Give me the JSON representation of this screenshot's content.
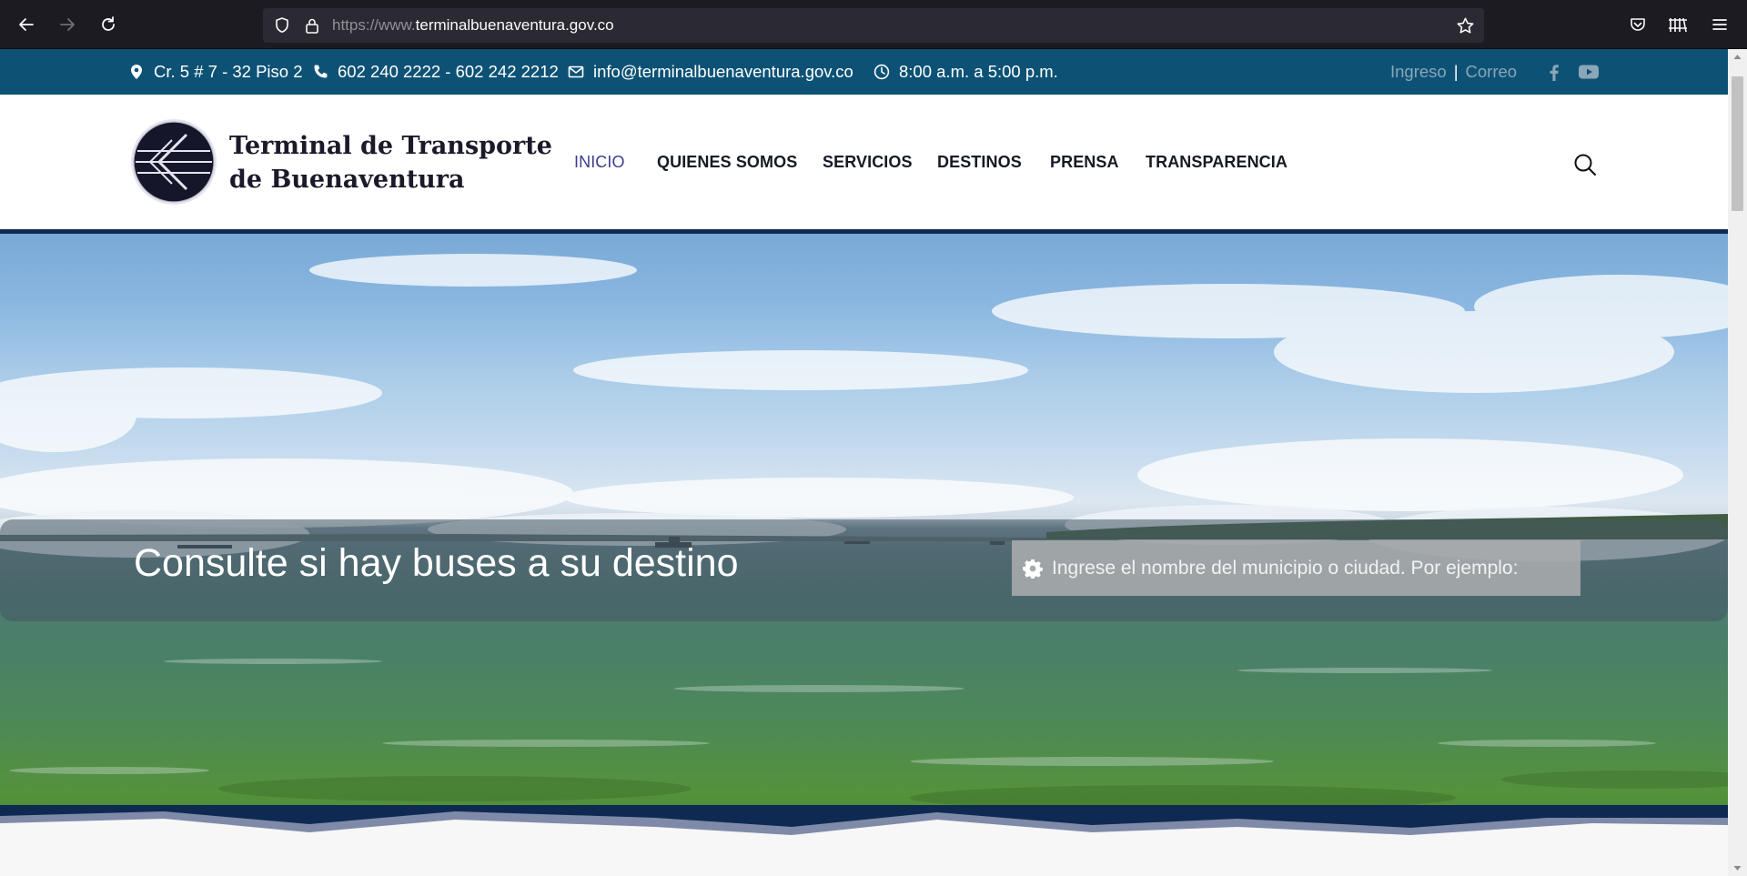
{
  "browser": {
    "url_prefix": "https://www.",
    "url_domain": "terminalbuenaventura.gov.co"
  },
  "topbar": {
    "address": "Cr. 5 # 7 - 32 Piso 2",
    "phone": "602 240 2222 - 602 242 2212",
    "email": "info@terminalbuenaventura.gov.co",
    "hours": "8:00 a.m. a 5:00 p.m.",
    "login_link": "Ingreso",
    "separator": "|",
    "mail_link": "Correo",
    "social_icons": [
      "facebook-icon",
      "youtube-icon"
    ]
  },
  "header": {
    "logo_line1": "Terminal de Transporte",
    "logo_line2": "de Buenaventura",
    "menu": [
      "INICIO",
      "QUIENES SOMOS",
      "SERVICIOS",
      "DESTINOS",
      "PRENSA",
      "TRANSPARENCIA"
    ],
    "active_menu": "INICIO"
  },
  "hero": {
    "title": "Consulte si hay buses a su destino",
    "search_placeholder": "Ingrese el nombre del municipio o ciudad. Por ejemplo:"
  },
  "colors": {
    "topbar": "#0d5275",
    "header_line": "#0f2a52",
    "active_menu": "#3d3d8f",
    "wave_dark": "#0f2a52",
    "wave_light": "#7f8aa8"
  }
}
